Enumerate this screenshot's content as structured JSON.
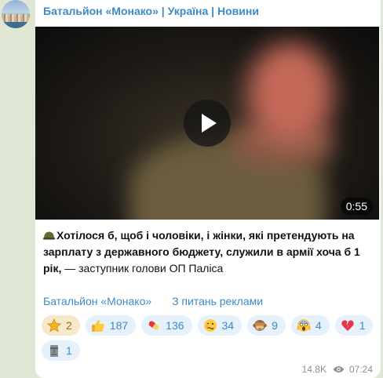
{
  "channel": {
    "name": "Батальйон «Монако» | Україна | Новини"
  },
  "video": {
    "duration": "0:55"
  },
  "post": {
    "bold_text": "Хотілося б, щоб і чоловіки, і жінки, які претендують на зарплату з державного бюджету, служили в армії хоча б 1 рік,",
    "attribution": " — заступник голови ОП Паліса"
  },
  "links": {
    "channel": "Батальйон «Монако»",
    "ads": "З питань реклами"
  },
  "reactions": [
    {
      "icon": "star-icon",
      "count": "2"
    },
    {
      "icon": "thumbs-up-icon",
      "count": "187"
    },
    {
      "icon": "pill-icon",
      "count": "136"
    },
    {
      "icon": "woozy-face-icon",
      "count": "34"
    },
    {
      "icon": "see-no-evil-monkey-icon",
      "count": "9"
    },
    {
      "icon": "screaming-face-icon",
      "count": "4"
    },
    {
      "icon": "broken-heart-icon",
      "count": "1"
    },
    {
      "icon": "moai-icon",
      "count": "1"
    }
  ],
  "footer": {
    "views": "14.8K",
    "time": "07:24"
  },
  "colors": {
    "link": "#3b8bc8",
    "background": "#dfe6d3"
  }
}
